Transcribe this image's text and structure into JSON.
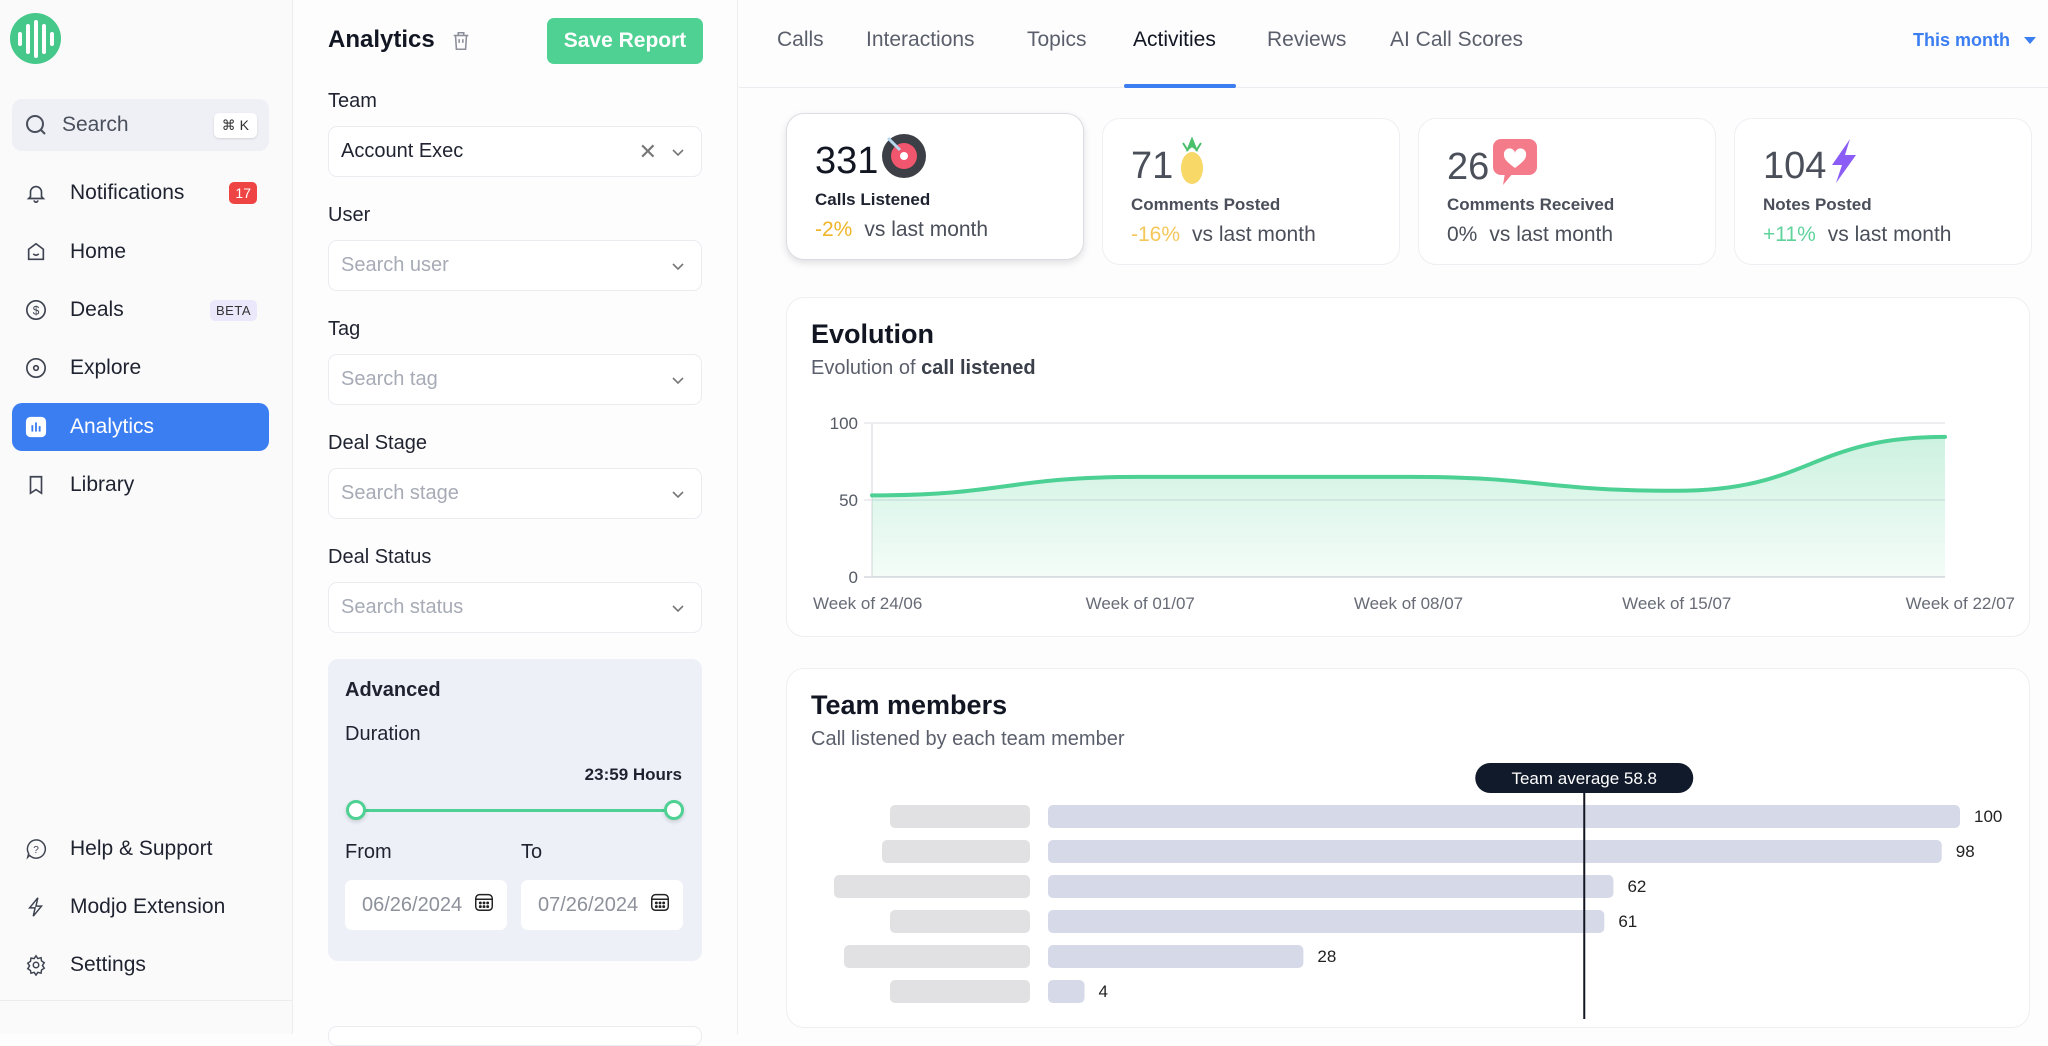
{
  "sidebar": {
    "search": {
      "label": "Search",
      "shortcut": "⌘ K"
    },
    "items": [
      {
        "label": "Notifications",
        "icon": "bell-icon",
        "badge": "17"
      },
      {
        "label": "Home",
        "icon": "home-icon"
      },
      {
        "label": "Deals",
        "icon": "dollar-icon",
        "badge": "BETA"
      },
      {
        "label": "Explore",
        "icon": "compass-icon"
      },
      {
        "label": "Analytics",
        "icon": "chart-icon",
        "active": true
      },
      {
        "label": "Library",
        "icon": "bookmark-icon"
      }
    ],
    "bottom_items": [
      {
        "label": "Help & Support",
        "icon": "help-icon"
      },
      {
        "label": "Modjo Extension",
        "icon": "bolt-icon"
      },
      {
        "label": "Settings",
        "icon": "gear-icon"
      }
    ]
  },
  "filters": {
    "title": "Analytics",
    "save_label": "Save Report",
    "team": {
      "label": "Team",
      "value": "Account Exec"
    },
    "user": {
      "label": "User",
      "placeholder": "Search user"
    },
    "tag": {
      "label": "Tag",
      "placeholder": "Search tag"
    },
    "deal_stage": {
      "label": "Deal Stage",
      "placeholder": "Search stage"
    },
    "deal_status": {
      "label": "Deal Status",
      "placeholder": "Search status"
    },
    "advanced": {
      "title": "Advanced",
      "duration_label": "Duration",
      "duration_value": "23:59 Hours",
      "duration_range": [
        0,
        1
      ],
      "from_label": "From",
      "from_value": "06/26/2024",
      "to_label": "To",
      "to_value": "07/26/2024"
    }
  },
  "tabs": {
    "items": [
      "Calls",
      "Interactions",
      "Topics",
      "Activities",
      "Reviews",
      "AI Call Scores"
    ],
    "active": "Activities",
    "period": "This month"
  },
  "kpis": [
    {
      "value": "331",
      "label": "Calls Listened",
      "delta": "-2%",
      "suffix": "vs last month",
      "delta_color": "#f0b429",
      "icon": "vinyl-record-icon",
      "selected": true
    },
    {
      "value": "71",
      "label": "Comments Posted",
      "delta": "-16%",
      "suffix": "vs last month",
      "delta_color": "#f5c75a",
      "icon": "pineapple-icon"
    },
    {
      "value": "26",
      "label": "Comments Received",
      "delta": "0%",
      "suffix": "vs last month",
      "delta_color": "#4a4f5a",
      "icon": "heart-bubble-icon"
    },
    {
      "value": "104",
      "label": "Notes Posted",
      "delta": "+11%",
      "suffix": "vs last month",
      "delta_color": "#5fd39b",
      "icon": "lightning-icon"
    }
  ],
  "evolution": {
    "title": "Evolution",
    "subtitle_prefix": "Evolution of",
    "subtitle_bold": "call listened"
  },
  "team_members": {
    "title": "Team members",
    "subtitle": "Call listened by each team member",
    "average_label": "Team average 58.8"
  },
  "chart_data": [
    {
      "type": "area",
      "title": "Evolution",
      "subtitle": "Evolution of call listened",
      "categories": [
        "Week of 24/06",
        "Week of 01/07",
        "Week of 08/07",
        "Week of 15/07",
        "Week of 22/07"
      ],
      "values": [
        53,
        65,
        65,
        56,
        91
      ],
      "yticks": [
        0,
        50,
        100
      ],
      "ylim": [
        0,
        100
      ],
      "grid": true,
      "color": "#4cd093"
    },
    {
      "type": "bar",
      "orientation": "horizontal",
      "title": "Team members",
      "subtitle": "Call listened by each team member",
      "categories": [
        "",
        "",
        "",
        "",
        "",
        ""
      ],
      "values": [
        100,
        98,
        62,
        61,
        28,
        4
      ],
      "average": 58.8,
      "xlim": [
        0,
        100
      ],
      "color": "#d6d9e7"
    }
  ]
}
